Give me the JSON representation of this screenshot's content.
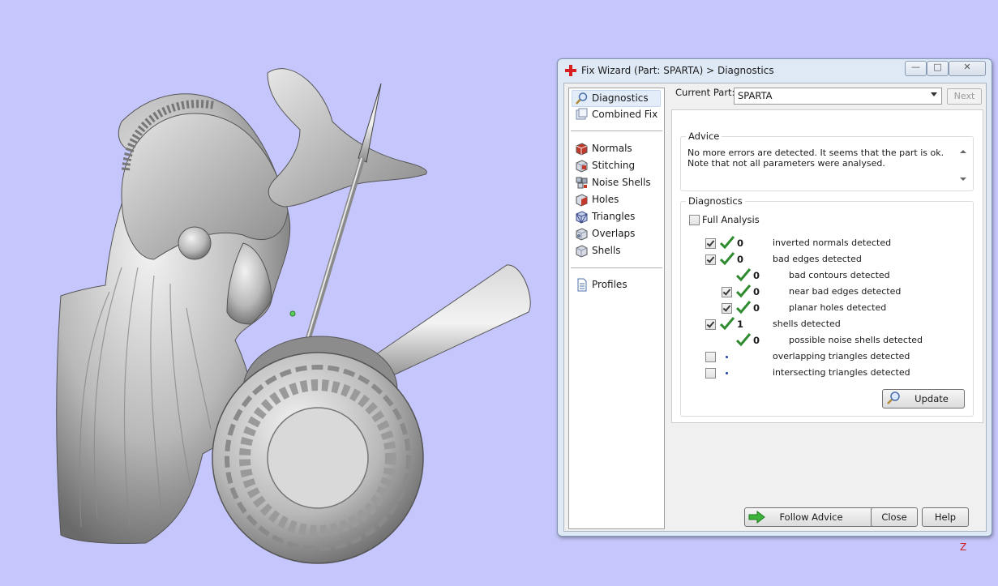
{
  "viewport": {
    "axis_label": "Z"
  },
  "window": {
    "title": "Fix Wizard (Part: SPARTA) > Diagnostics",
    "controls": {
      "minimize": "—",
      "maximize": "□",
      "close": "✕"
    }
  },
  "nav": {
    "top_items": [
      {
        "label": "Diagnostics",
        "icon": "magnifier-icon",
        "selected": true
      },
      {
        "label": "Combined Fix",
        "icon": "combined-fix-icon"
      }
    ],
    "fix_items": [
      {
        "label": "Normals",
        "icon": "normals-cube-icon"
      },
      {
        "label": "Stitching",
        "icon": "stitching-cube-icon"
      },
      {
        "label": "Noise Shells",
        "icon": "noise-shells-icon"
      },
      {
        "label": "Holes",
        "icon": "holes-cube-icon"
      },
      {
        "label": "Triangles",
        "icon": "triangles-cube-icon"
      },
      {
        "label": "Overlaps",
        "icon": "overlaps-cube-icon"
      },
      {
        "label": "Shells",
        "icon": "shells-cube-icon"
      }
    ],
    "bottom_items": [
      {
        "label": "Profiles",
        "icon": "document-icon"
      }
    ]
  },
  "current_part": {
    "label": "Current Part:",
    "value": "SPARTA"
  },
  "next_button": "Next",
  "advice": {
    "title": "Advice",
    "text": "No more errors are detected. It seems that the part is ok. Note that not all parameters were analysed."
  },
  "diagnostics": {
    "title": "Diagnostics",
    "full_analysis": {
      "label": "Full Analysis",
      "checked": false
    },
    "rows": [
      {
        "checkbox": true,
        "checked": true,
        "status": "ok",
        "count": "0",
        "label": "inverted normals detected",
        "indent": 0
      },
      {
        "checkbox": true,
        "checked": true,
        "status": "ok",
        "count": "0",
        "label": "bad edges detected",
        "indent": 0
      },
      {
        "checkbox": false,
        "checked": false,
        "status": "ok",
        "count": "0",
        "label": "bad contours detected",
        "indent": 1
      },
      {
        "checkbox": true,
        "checked": true,
        "status": "ok",
        "count": "0",
        "label": "near bad edges detected",
        "indent": 1
      },
      {
        "checkbox": true,
        "checked": true,
        "status": "ok",
        "count": "0",
        "label": "planar holes detected",
        "indent": 1
      },
      {
        "checkbox": true,
        "checked": true,
        "status": "ok",
        "count": "1",
        "label": "shells detected",
        "indent": 0
      },
      {
        "checkbox": false,
        "checked": false,
        "status": "ok",
        "count": "0",
        "label": "possible noise shells detected",
        "indent": 1
      },
      {
        "checkbox": true,
        "checked": false,
        "status": "pending",
        "count": "",
        "label": "overlapping triangles detected",
        "indent": 0
      },
      {
        "checkbox": true,
        "checked": false,
        "status": "pending",
        "count": "",
        "label": "intersecting triangles detected",
        "indent": 0
      }
    ],
    "update_button": "Update"
  },
  "footer": {
    "follow_advice": "Follow Advice",
    "close": "Close",
    "help": "Help"
  },
  "colors": {
    "viewport_bg": "#c5c6fb",
    "ok_tick": "#2e8b2e",
    "pending_dot": "#1f3fa8",
    "title_cross": "#d81e1e"
  }
}
